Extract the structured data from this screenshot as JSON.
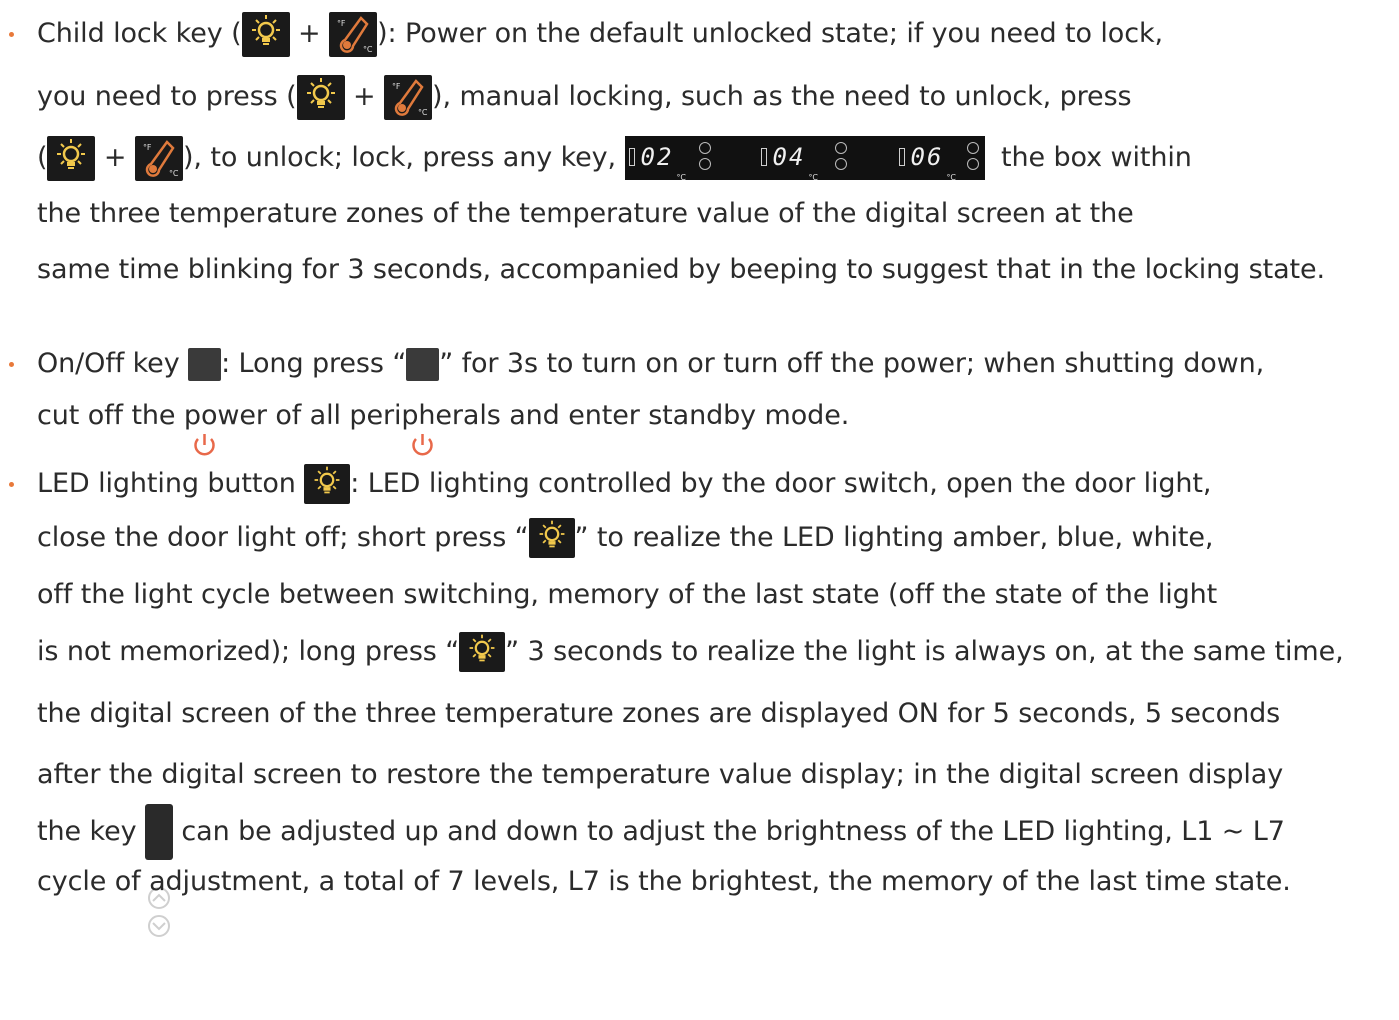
{
  "colors": {
    "bullet": "#e8793a",
    "icon_bg": "#1a1a1a",
    "bulb": "#f2c94c",
    "therm": "#e07a3c",
    "power": "#e8694a"
  },
  "icons": {
    "light": "lightbulb-icon",
    "temp": "thermometer-icon",
    "power": "power-icon",
    "updown": "up-down-arrow-icon"
  },
  "display": {
    "zones": [
      "02",
      "04",
      "06"
    ],
    "unit": "°C"
  },
  "child_lock": {
    "l1a": "Child lock key (",
    "l1b": " + ",
    "l1c": "): Power on the default unlocked state; if you need to lock,",
    "l2a": "you need to press (",
    "l2b": " + ",
    "l2c": "), manual locking, such as the need to unlock, press",
    "l3a": "(",
    "l3b": " + ",
    "l3c": "), to unlock; lock, press any key, ",
    "l3d": " the box within",
    "l4": "the three temperature zones of the temperature value of the digital screen at the",
    "l5": "same time blinking for 3 seconds, accompanied by beeping to suggest that in the locking state."
  },
  "onoff": {
    "l1a": "On/Off key ",
    "l1b": ": Long press “",
    "l1c": "” for 3s to turn on or turn off the power; when shutting down,",
    "l2": "cut off the power of all peripherals and enter standby mode."
  },
  "led": {
    "l1a": "LED lighting button ",
    "l1b": ": LED lighting controlled by the door switch, open the door light,",
    "l2a": "close the door light off; short press “",
    "l2b": "” to realize the LED lighting amber, blue, white,",
    "l3": "off the light cycle between switching, memory of the last state (off the state of the light",
    "l4a": "is not memorized); long press “",
    "l4b": "” 3 seconds to realize the light is always on, at the same time,",
    "l5": "the digital screen of the three temperature zones are displayed ON for 5 seconds, 5 seconds",
    "l6": "after the digital screen to restore the temperature value display; in the digital screen display",
    "l7a": "the key ",
    "l7b": " can be adjusted up and down to adjust the brightness of the LED lighting, L1 ~ L7",
    "l8": "cycle of adjustment, a total of 7 levels, L7 is the brightest, the memory of the last time state."
  }
}
